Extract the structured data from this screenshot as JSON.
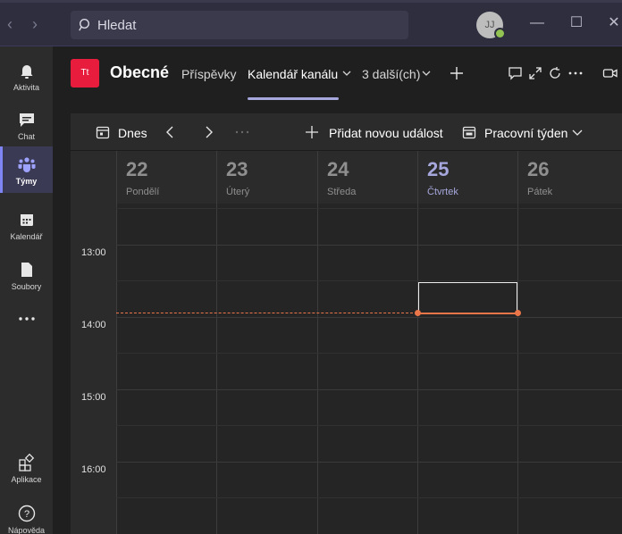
{
  "titlebar": {
    "search_placeholder": "Hledat",
    "avatar_initials": "JJ"
  },
  "rail": {
    "items": [
      {
        "label": "Aktivita",
        "icon": "bell-icon"
      },
      {
        "label": "Chat",
        "icon": "chat-icon"
      },
      {
        "label": "Týmy",
        "icon": "teams-icon",
        "active": true
      },
      {
        "label": "Kalendář",
        "icon": "calendar-icon"
      },
      {
        "label": "Soubory",
        "icon": "file-icon"
      },
      {
        "label": "",
        "icon": "more-icon"
      },
      {
        "label": "Aplikace",
        "icon": "apps-icon"
      },
      {
        "label": "Nápověda",
        "icon": "help-icon"
      }
    ]
  },
  "header": {
    "team_initials": "Tt",
    "channel_title": "Obecné",
    "tabs": [
      {
        "label": "Příspěvky"
      },
      {
        "label": "Kalendář kanálu",
        "active": true
      },
      {
        "label": "3 další(ch)"
      }
    ]
  },
  "calendar": {
    "today_label": "Dnes",
    "new_event_label": "Přidat novou událost",
    "view_label": "Pracovní týden",
    "days": [
      {
        "num": "22",
        "name": "Pondělí"
      },
      {
        "num": "23",
        "name": "Úterý"
      },
      {
        "num": "24",
        "name": "Středa"
      },
      {
        "num": "25",
        "name": "Čtvrtek",
        "today": true
      },
      {
        "num": "26",
        "name": "Pátek"
      }
    ],
    "times": [
      "13:00",
      "14:00",
      "15:00",
      "16:00"
    ]
  },
  "colors": {
    "accent": "#a6a7dc",
    "now_line": "#e97548",
    "team_tile": "#e81c3c"
  }
}
